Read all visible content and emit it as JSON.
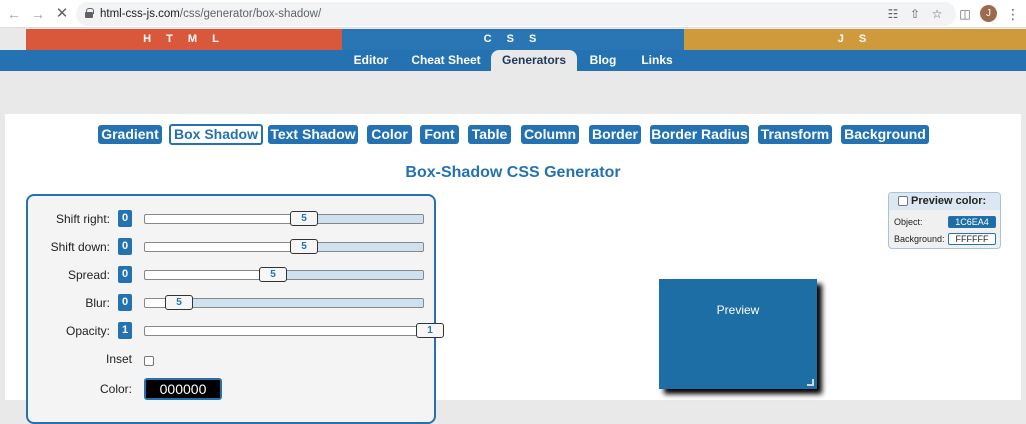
{
  "browser": {
    "url_host": "html-css-js.com",
    "url_path": "/css/generator/box-shadow/",
    "profile_initial": "J"
  },
  "lang_tabs": [
    "H T M L",
    "C S S",
    "J S"
  ],
  "sub_nav": [
    "Editor",
    "Cheat Sheet",
    "Generators",
    "Blog",
    "Links"
  ],
  "generators": [
    "Gradient",
    "Box Shadow",
    "Text Shadow",
    "Color",
    "Font",
    "Table",
    "Column",
    "Border",
    "Border Radius",
    "Transform",
    "Background"
  ],
  "title": "Box-Shadow CSS Generator",
  "controls": {
    "shift_right": {
      "label": "Shift right:",
      "value": "0",
      "slider": "5"
    },
    "shift_down": {
      "label": "Shift down:",
      "value": "0",
      "slider": "5"
    },
    "spread": {
      "label": "Spread:",
      "value": "0",
      "slider": "5"
    },
    "blur": {
      "label": "Blur:",
      "value": "0",
      "slider": "5"
    },
    "opacity": {
      "label": "Opacity:",
      "value": "1",
      "slider": "1"
    },
    "inset_label": "Inset",
    "color_label": "Color:",
    "color_value": "000000"
  },
  "preview": {
    "label": "Preview"
  },
  "preview_color": {
    "title": "Preview color:",
    "object_label": "Object:",
    "object_value": "1C6EA4",
    "background_label": "Background:",
    "background_value": "FFFFFF"
  },
  "colors": {
    "accent": "#2472b2",
    "html_tab": "#d9583b",
    "js_tab": "#cf9a3c",
    "preview_object": "#1C6EA4"
  }
}
